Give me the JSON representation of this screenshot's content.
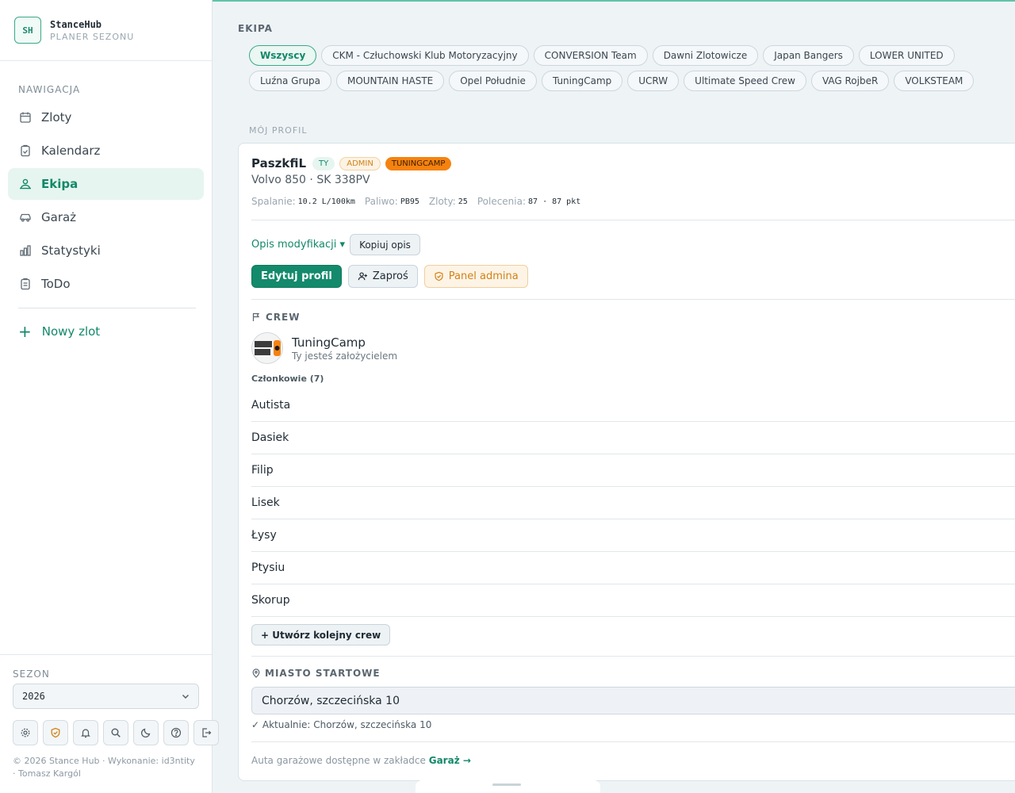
{
  "brand": {
    "logo": "SH",
    "name": "StanceHub",
    "subtitle": "PLANER SEZONU"
  },
  "nav": {
    "label": "NAWIGACJA",
    "items": [
      {
        "label": "Zloty",
        "icon": "calendar-icon"
      },
      {
        "label": "Kalendarz",
        "icon": "clipboard-icon"
      },
      {
        "label": "Ekipa",
        "icon": "users-icon",
        "active": true
      },
      {
        "label": "Garaż",
        "icon": "car-icon"
      },
      {
        "label": "Statystyki",
        "icon": "bar-chart-icon"
      },
      {
        "label": "ToDo",
        "icon": "checklist-icon"
      }
    ],
    "new_rally": "Nowy zlot"
  },
  "season": {
    "label": "SEZON",
    "value": "2026"
  },
  "tools": [
    "gear-icon",
    "shield-icon",
    "bell-icon",
    "search-icon",
    "moon-icon",
    "help-icon",
    "logout-icon"
  ],
  "footer": {
    "text": "© 2026 Stance Hub · Wykonanie: id3ntity · Tomasz Kargól"
  },
  "ekipa": {
    "title": "EKIPA",
    "chips": [
      "Wszyscy",
      "CKM - Człuchowski Klub Motoryzacyjny",
      "CONVERSION Team",
      "Dawni Zlotowicze",
      "Japan Bangers",
      "LOWER UNITED",
      "Luźna Grupa",
      "MOUNTAIN HASTE",
      "Opel Południe",
      "TuningCamp",
      "UCRW",
      "Ultimate Speed Crew",
      "VAG RojbeR",
      "VOLKSTEAM"
    ],
    "active_chip": "Wszyscy"
  },
  "profile": {
    "label": "MÓJ PROFIL",
    "name": "PaszkfiL",
    "badges": {
      "you": "TY",
      "admin": "ADMIN",
      "crew": "TUNINGCAMP"
    },
    "car": "Volvo 850 · SK 338PV",
    "stats": {
      "fuel_use_label": "Spalanie:",
      "fuel_use": "10.2 L/100km",
      "fuel_label": "Paliwo:",
      "fuel": "PB95",
      "rallies_label": "Zloty:",
      "rallies": "25",
      "referrals_label": "Polecenia:",
      "referrals": "87 · 87 pkt"
    },
    "mods_toggle": "Opis modyfikacji ▾",
    "copy_desc": "Kopiuj opis",
    "edit_btn": "Edytuj profil",
    "invite_btn": "Zaproś",
    "admin_btn": "Panel admina"
  },
  "crew": {
    "heading": "CREW",
    "name": "TuningCamp",
    "subtitle": "Ty jesteś założycielem",
    "members_label": "Członkowie (7)",
    "members": [
      "Autista",
      "Dasiek",
      "Filip",
      "Lisek",
      "Łysy",
      "Ptysiu",
      "Skorup"
    ],
    "create_btn": "+ Utwórz kolejny crew"
  },
  "city": {
    "heading": "MIASTO STARTOWE",
    "value": "Chorzów, szczecińska 10",
    "current": "✓ Aktualnie: Chorzów, szczecińska 10"
  },
  "garage_note": {
    "text": "Auta garażowe dostępne w zakładce ",
    "link": "Garaż →"
  },
  "colors": {
    "accent": "#138a6b",
    "warn": "#d18217",
    "crew_badge": "#f5820f"
  }
}
